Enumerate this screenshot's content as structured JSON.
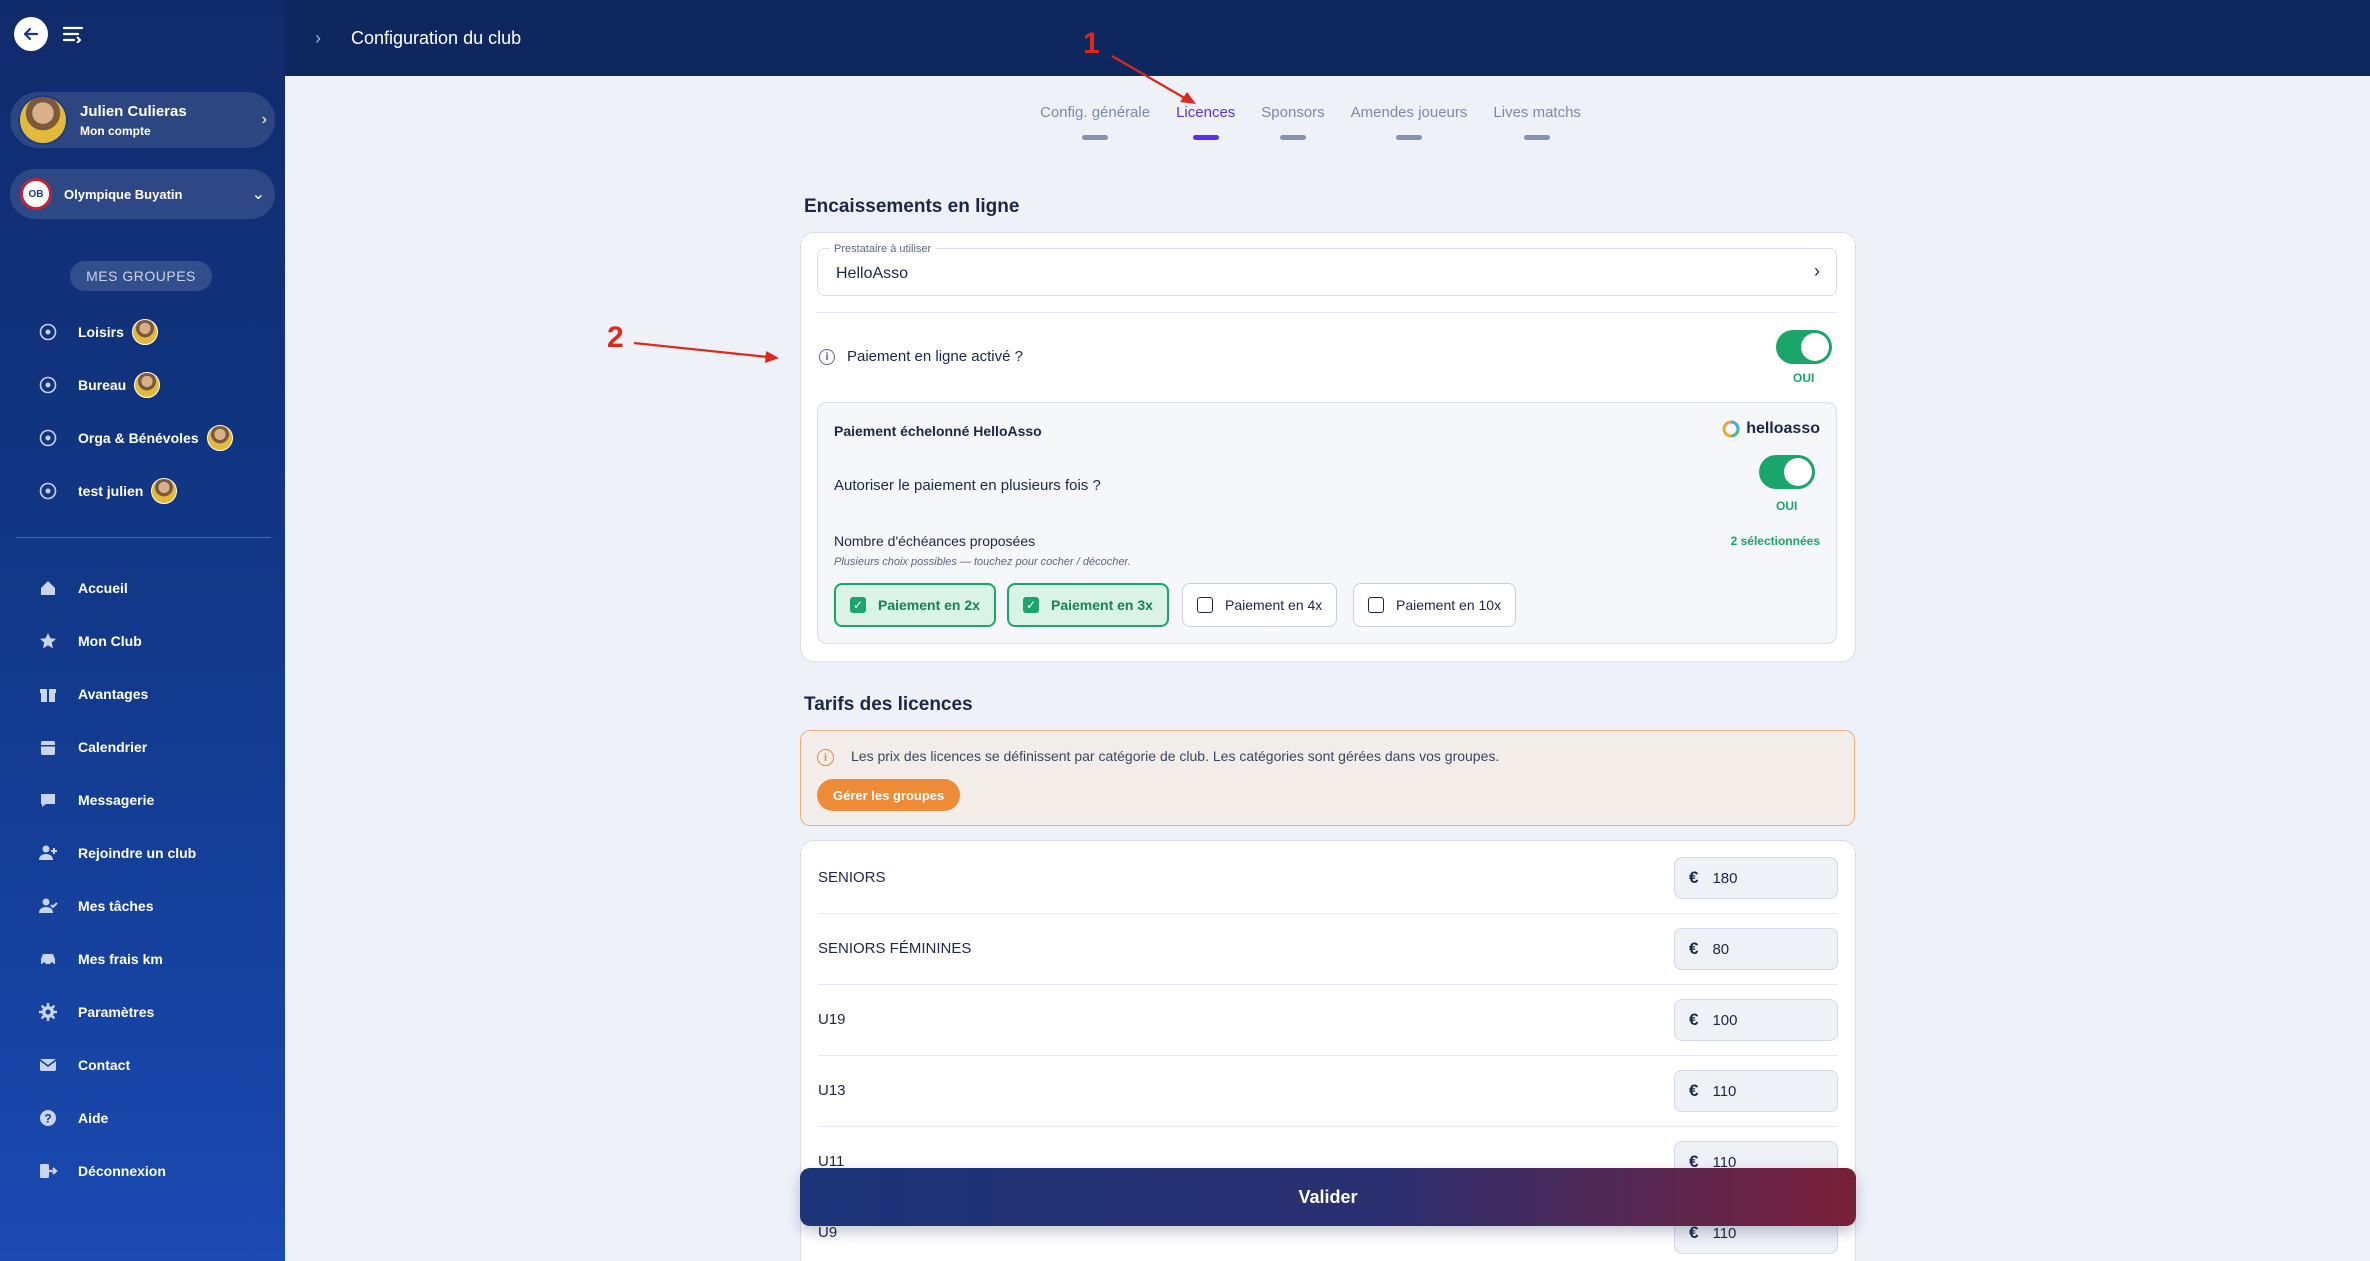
{
  "sidebar": {
    "account": {
      "name": "Julien Culieras",
      "subtitle": "Mon compte"
    },
    "club": {
      "name": "Olympique Buyatin"
    },
    "groups_title": "MES GROUPES",
    "groups": [
      {
        "label": "Loisirs"
      },
      {
        "label": "Bureau"
      },
      {
        "label": "Orga & Bénévoles"
      },
      {
        "label": "test julien"
      }
    ],
    "nav": [
      {
        "label": "Accueil",
        "icon": "home-icon"
      },
      {
        "label": "Mon Club",
        "icon": "star-icon"
      },
      {
        "label": "Avantages",
        "icon": "gift-icon"
      },
      {
        "label": "Calendrier",
        "icon": "calendar-icon"
      },
      {
        "label": "Messagerie",
        "icon": "chat-icon"
      },
      {
        "label": "Rejoindre un club",
        "icon": "user-plus-icon"
      },
      {
        "label": "Mes tâches",
        "icon": "user-check-icon"
      },
      {
        "label": "Mes frais km",
        "icon": "car-icon"
      },
      {
        "label": "Paramètres",
        "icon": "gear-icon"
      },
      {
        "label": "Contact",
        "icon": "mail-icon"
      },
      {
        "label": "Aide",
        "icon": "help-icon"
      },
      {
        "label": "Déconnexion",
        "icon": "logout-icon"
      }
    ]
  },
  "topbar": {
    "title": "Configuration du club"
  },
  "tabs": [
    {
      "label": "Config. générale",
      "active": false
    },
    {
      "label": "Licences",
      "active": true
    },
    {
      "label": "Sponsors",
      "active": false
    },
    {
      "label": "Amendes joueurs",
      "active": false
    },
    {
      "label": "Lives matchs",
      "active": false
    }
  ],
  "annotations": {
    "one": "1",
    "two": "2"
  },
  "online_payments": {
    "title": "Encaissements en ligne",
    "provider_label": "Prestataire à utiliser",
    "provider_value": "HelloAsso",
    "payment_toggle_label": "Paiement en ligne activé ?",
    "payment_toggle_state": "OUI",
    "installments": {
      "title": "Paiement échelonné HelloAsso",
      "brand": "helloasso",
      "allow_label": "Autoriser le paiement en plusieurs fois ?",
      "allow_state": "OUI",
      "count_label": "Nombre d'échéances proposées",
      "count_hint": "Plusieurs choix possibles — touchez pour cocher / décocher.",
      "selected_count": "2 sélectionnées",
      "options": [
        {
          "label": "Paiement en 2x",
          "checked": true
        },
        {
          "label": "Paiement en 3x",
          "checked": true
        },
        {
          "label": "Paiement en 4x",
          "checked": false
        },
        {
          "label": "Paiement en 10x",
          "checked": false
        }
      ]
    }
  },
  "licence_prices": {
    "title": "Tarifs des licences",
    "notice": "Les prix des licences se définissent par catégorie de club. Les catégories sont gérées dans vos groupes.",
    "notice_button": "Gérer les groupes",
    "currency": "€",
    "rows": [
      {
        "label": "SENIORS",
        "value": "180"
      },
      {
        "label": "SENIORS FÉMININES",
        "value": "80"
      },
      {
        "label": "U19",
        "value": "100"
      },
      {
        "label": "U13",
        "value": "110"
      },
      {
        "label": "U11",
        "value": "110"
      },
      {
        "label": "U9",
        "value": "110"
      }
    ]
  },
  "submit_label": "Valider",
  "colors": {
    "sidebar": "#123a8e",
    "topbar": "#0e275f",
    "accent": "#5a30e8",
    "success": "#1aa56b",
    "warning": "#ef8a36",
    "annotation": "#e0281a"
  }
}
